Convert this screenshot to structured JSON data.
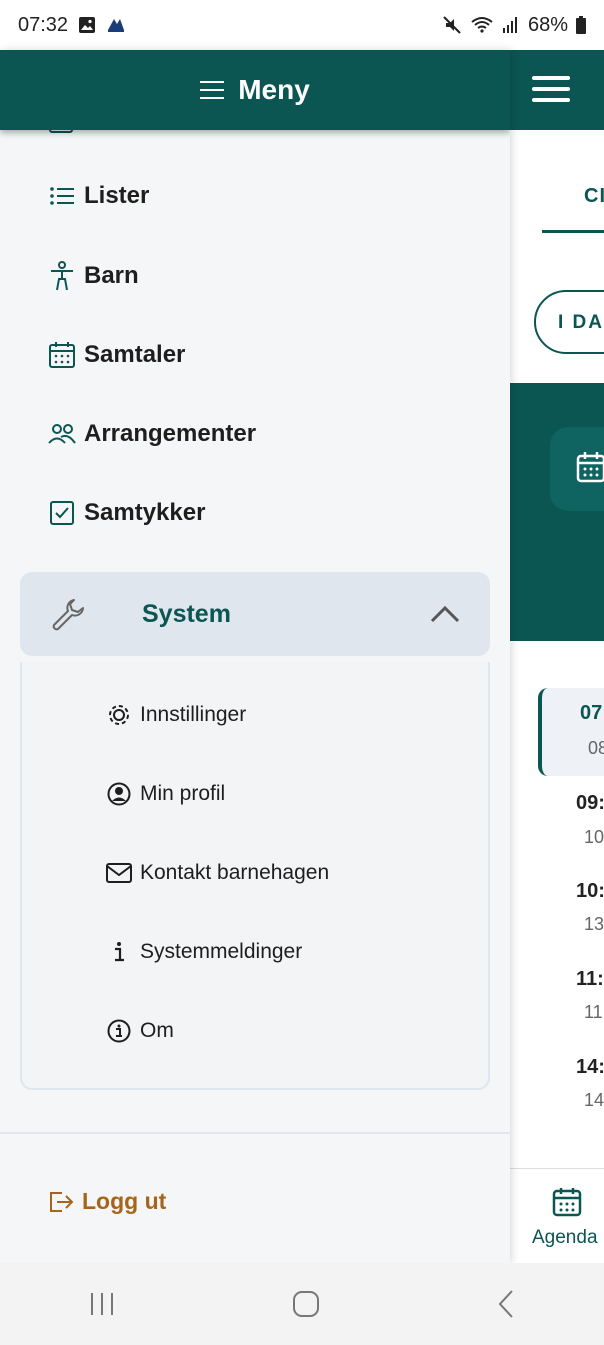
{
  "status_bar": {
    "time": "07:32",
    "battery": "68%",
    "icons": [
      "image-icon",
      "app-notification-icon",
      "mute-icon",
      "wifi-icon",
      "signal-icon",
      "battery-icon"
    ]
  },
  "drawer": {
    "title": "Meny",
    "partial_item_label": "",
    "items": [
      {
        "label": "Lister",
        "icon": "list-icon"
      },
      {
        "label": "Barn",
        "icon": "child-icon"
      },
      {
        "label": "Samtaler",
        "icon": "calendar-icon"
      },
      {
        "label": "Arrangementer",
        "icon": "group-icon"
      },
      {
        "label": "Samtykker",
        "icon": "checkbox-icon"
      }
    ],
    "system": {
      "label": "System",
      "expanded": true,
      "items": [
        {
          "label": "Innstillinger",
          "icon": "gear-icon"
        },
        {
          "label": "Min profil",
          "icon": "profile-icon"
        },
        {
          "label": "Kontakt barnehagen",
          "icon": "mail-icon"
        },
        {
          "label": "Systemmeldinger",
          "icon": "info-letter-icon"
        },
        {
          "label": "Om",
          "icon": "info-circle-icon"
        }
      ]
    },
    "logout_label": "Logg ut"
  },
  "background_app": {
    "tab_label": "CI",
    "pill_label": "I DAG",
    "times": [
      {
        "start": "07",
        "end": "08"
      },
      {
        "start": "09:",
        "end": "10"
      },
      {
        "start": "10:",
        "end": "13"
      },
      {
        "start": "11:",
        "end": "11"
      },
      {
        "start": "14:",
        "end": "14"
      }
    ],
    "bottom_nav_label": "Agenda"
  },
  "colors": {
    "primary": "#0b5553",
    "accent_logout": "#a6651a",
    "drawer_bg": "#f5f6f7",
    "system_header_bg": "#dfe6ee"
  }
}
